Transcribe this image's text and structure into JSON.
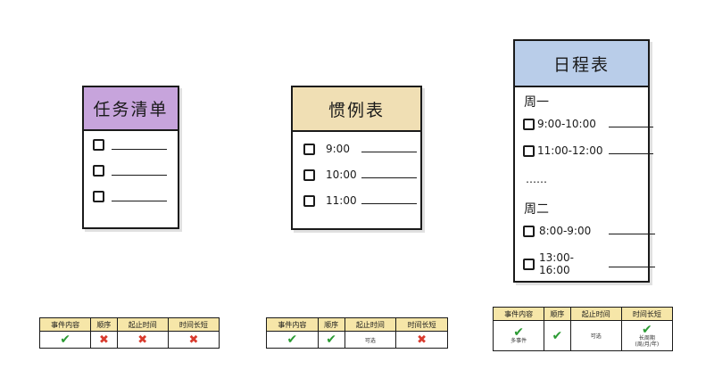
{
  "colors": {
    "purple": "#c7a4dc",
    "tan": "#f0dfb4",
    "blue": "#b9cde9",
    "header_yellow": "#f6e6a8",
    "check": "#2b9b33",
    "cross": "#d93b2e"
  },
  "icons": {
    "check": "✔",
    "cross": "✖"
  },
  "cards": {
    "task": {
      "title": "任务清单"
    },
    "habit": {
      "title": "惯例表",
      "times": [
        "9:00",
        "10:00",
        "11:00"
      ]
    },
    "schedule": {
      "title": "日程表",
      "day1": "周一",
      "day1_slots": [
        "9:00-10:00",
        "11:00-12:00"
      ],
      "ellipsis": "……",
      "day2": "周二",
      "day2_slots": [
        "8:00-9:00",
        "13:00-16:00"
      ]
    }
  },
  "table_headers": [
    "事件内容",
    "顺序",
    "起止时间",
    "时间长短"
  ],
  "tables": {
    "t1": {
      "cells": [
        "✔",
        "✖",
        "✖",
        "✖"
      ]
    },
    "t2": {
      "cells": [
        "✔",
        "✔",
        "可选",
        "✖"
      ]
    },
    "t3": {
      "c1_note": "多事件",
      "c3": "可选",
      "c4_note1": "长周期",
      "c4_note2": "(周/月/年)"
    }
  }
}
